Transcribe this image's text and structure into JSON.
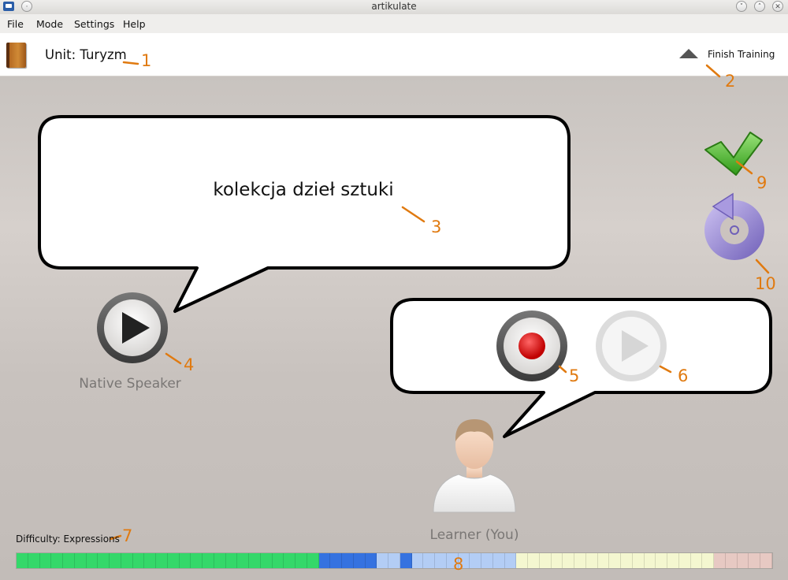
{
  "window": {
    "title": "artikulate"
  },
  "menu": {
    "file": "File",
    "mode": "Mode",
    "settings": "Settings",
    "help": "Help"
  },
  "unit": {
    "title": "Unit: Turyzm"
  },
  "finish": {
    "label": "Finish Training"
  },
  "phrase": {
    "text": "kolekcja dzieł sztuki"
  },
  "native": {
    "label": "Native Speaker"
  },
  "learner": {
    "label": "Learner (You)"
  },
  "difficulty": {
    "label": "Difficulty: Expressions"
  },
  "colors": {
    "accent": "#e07a10",
    "record": "#d40000",
    "check": "#4caf2a",
    "retry": "#8a7ac8"
  },
  "progress": {
    "segments": [
      "green",
      "green",
      "green",
      "green",
      "green",
      "green",
      "green",
      "green",
      "green",
      "green",
      "green",
      "green",
      "green",
      "green",
      "green",
      "green",
      "green",
      "green",
      "green",
      "green",
      "green",
      "green",
      "green",
      "green",
      "green",
      "green",
      "blue",
      "blue",
      "blue",
      "blue",
      "blue",
      "lightblue",
      "lightblue",
      "blue",
      "lightblue",
      "lightblue",
      "lightblue",
      "lightblue",
      "lightblue",
      "lightblue",
      "lightblue",
      "lightblue",
      "lightblue",
      "yellow",
      "yellow",
      "yellow",
      "yellow",
      "yellow",
      "yellow",
      "yellow",
      "yellow",
      "yellow",
      "yellow",
      "yellow",
      "yellow",
      "yellow",
      "yellow",
      "yellow",
      "yellow",
      "yellow",
      "pink",
      "pink",
      "pink",
      "pink",
      "pink"
    ],
    "palette": {
      "green": "#34d86a",
      "blue": "#3572e0",
      "lightblue": "#b3cdf5",
      "yellow": "#f4f7d0",
      "pink": "#e7c9c3"
    }
  },
  "callouts": [
    "1",
    "2",
    "3",
    "4",
    "5",
    "6",
    "7",
    "8",
    "9",
    "10"
  ],
  "icons": {
    "app": "app-icon",
    "minimize": "chevron-down-icon",
    "maximize": "chevron-up-icon",
    "close": "close-icon"
  }
}
